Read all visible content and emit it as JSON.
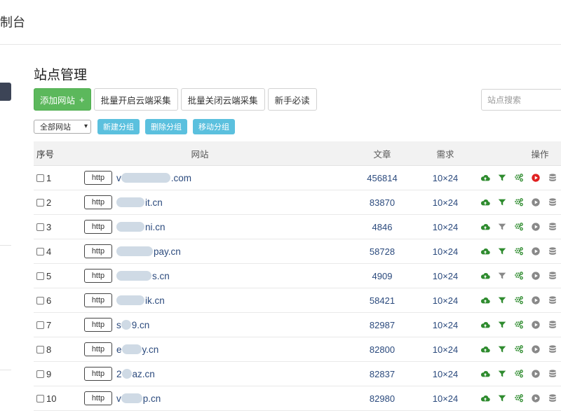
{
  "header": {
    "title": "制台"
  },
  "page": {
    "title": "站点管理"
  },
  "toolbar": {
    "add_site": "添加网站",
    "add_plus": "+",
    "batch_open": "批量开启云端采集",
    "batch_close": "批量关闭云端采集",
    "guide": "新手必读"
  },
  "search": {
    "placeholder": "站点搜索"
  },
  "filter": {
    "group_select": "全部网站",
    "new_group": "新建分组",
    "delete_group": "删除分组",
    "move_group": "移动分组"
  },
  "table": {
    "headers": {
      "no": "序号",
      "site": "网站",
      "articles": "文章",
      "demand": "需求",
      "ops": "操作"
    },
    "rows": [
      {
        "no": "1",
        "protocol": "http",
        "domain": ".com",
        "prefix": "v",
        "articles": "456814",
        "demand": "10×24"
      },
      {
        "no": "2",
        "protocol": "http",
        "domain": "it.cn",
        "prefix": "",
        "articles": "83870",
        "demand": "10×24"
      },
      {
        "no": "3",
        "protocol": "http",
        "domain": "ni.cn",
        "prefix": "",
        "articles": "4846",
        "demand": "10×24"
      },
      {
        "no": "4",
        "protocol": "http",
        "domain": "pay.cn",
        "prefix": "",
        "articles": "58728",
        "demand": "10×24"
      },
      {
        "no": "5",
        "protocol": "http",
        "domain": "s.cn",
        "prefix": "",
        "articles": "4909",
        "demand": "10×24"
      },
      {
        "no": "6",
        "protocol": "http",
        "domain": "ik.cn",
        "prefix": "",
        "articles": "58421",
        "demand": "10×24"
      },
      {
        "no": "7",
        "protocol": "http",
        "domain": "9.cn",
        "prefix": "s",
        "articles": "82987",
        "demand": "10×24"
      },
      {
        "no": "8",
        "protocol": "http",
        "domain": "y.cn",
        "prefix": "e",
        "articles": "82800",
        "demand": "10×24"
      },
      {
        "no": "9",
        "protocol": "http",
        "domain": "az.cn",
        "prefix": "2",
        "articles": "82837",
        "demand": "10×24"
      },
      {
        "no": "10",
        "protocol": "http",
        "domain": "p.cn",
        "prefix": "v",
        "articles": "82980",
        "demand": "10×24"
      }
    ]
  },
  "colors": {
    "green": "#5cb85c",
    "icon_green": "#2e8b2e",
    "icon_gray": "#888888",
    "icon_red": "#e02020",
    "info_blue": "#5bc0de",
    "link_blue": "#2b4a7d"
  },
  "icons": [
    "cloud-upload-icon",
    "filter-icon",
    "gears-icon",
    "play-icon",
    "database-icon"
  ]
}
